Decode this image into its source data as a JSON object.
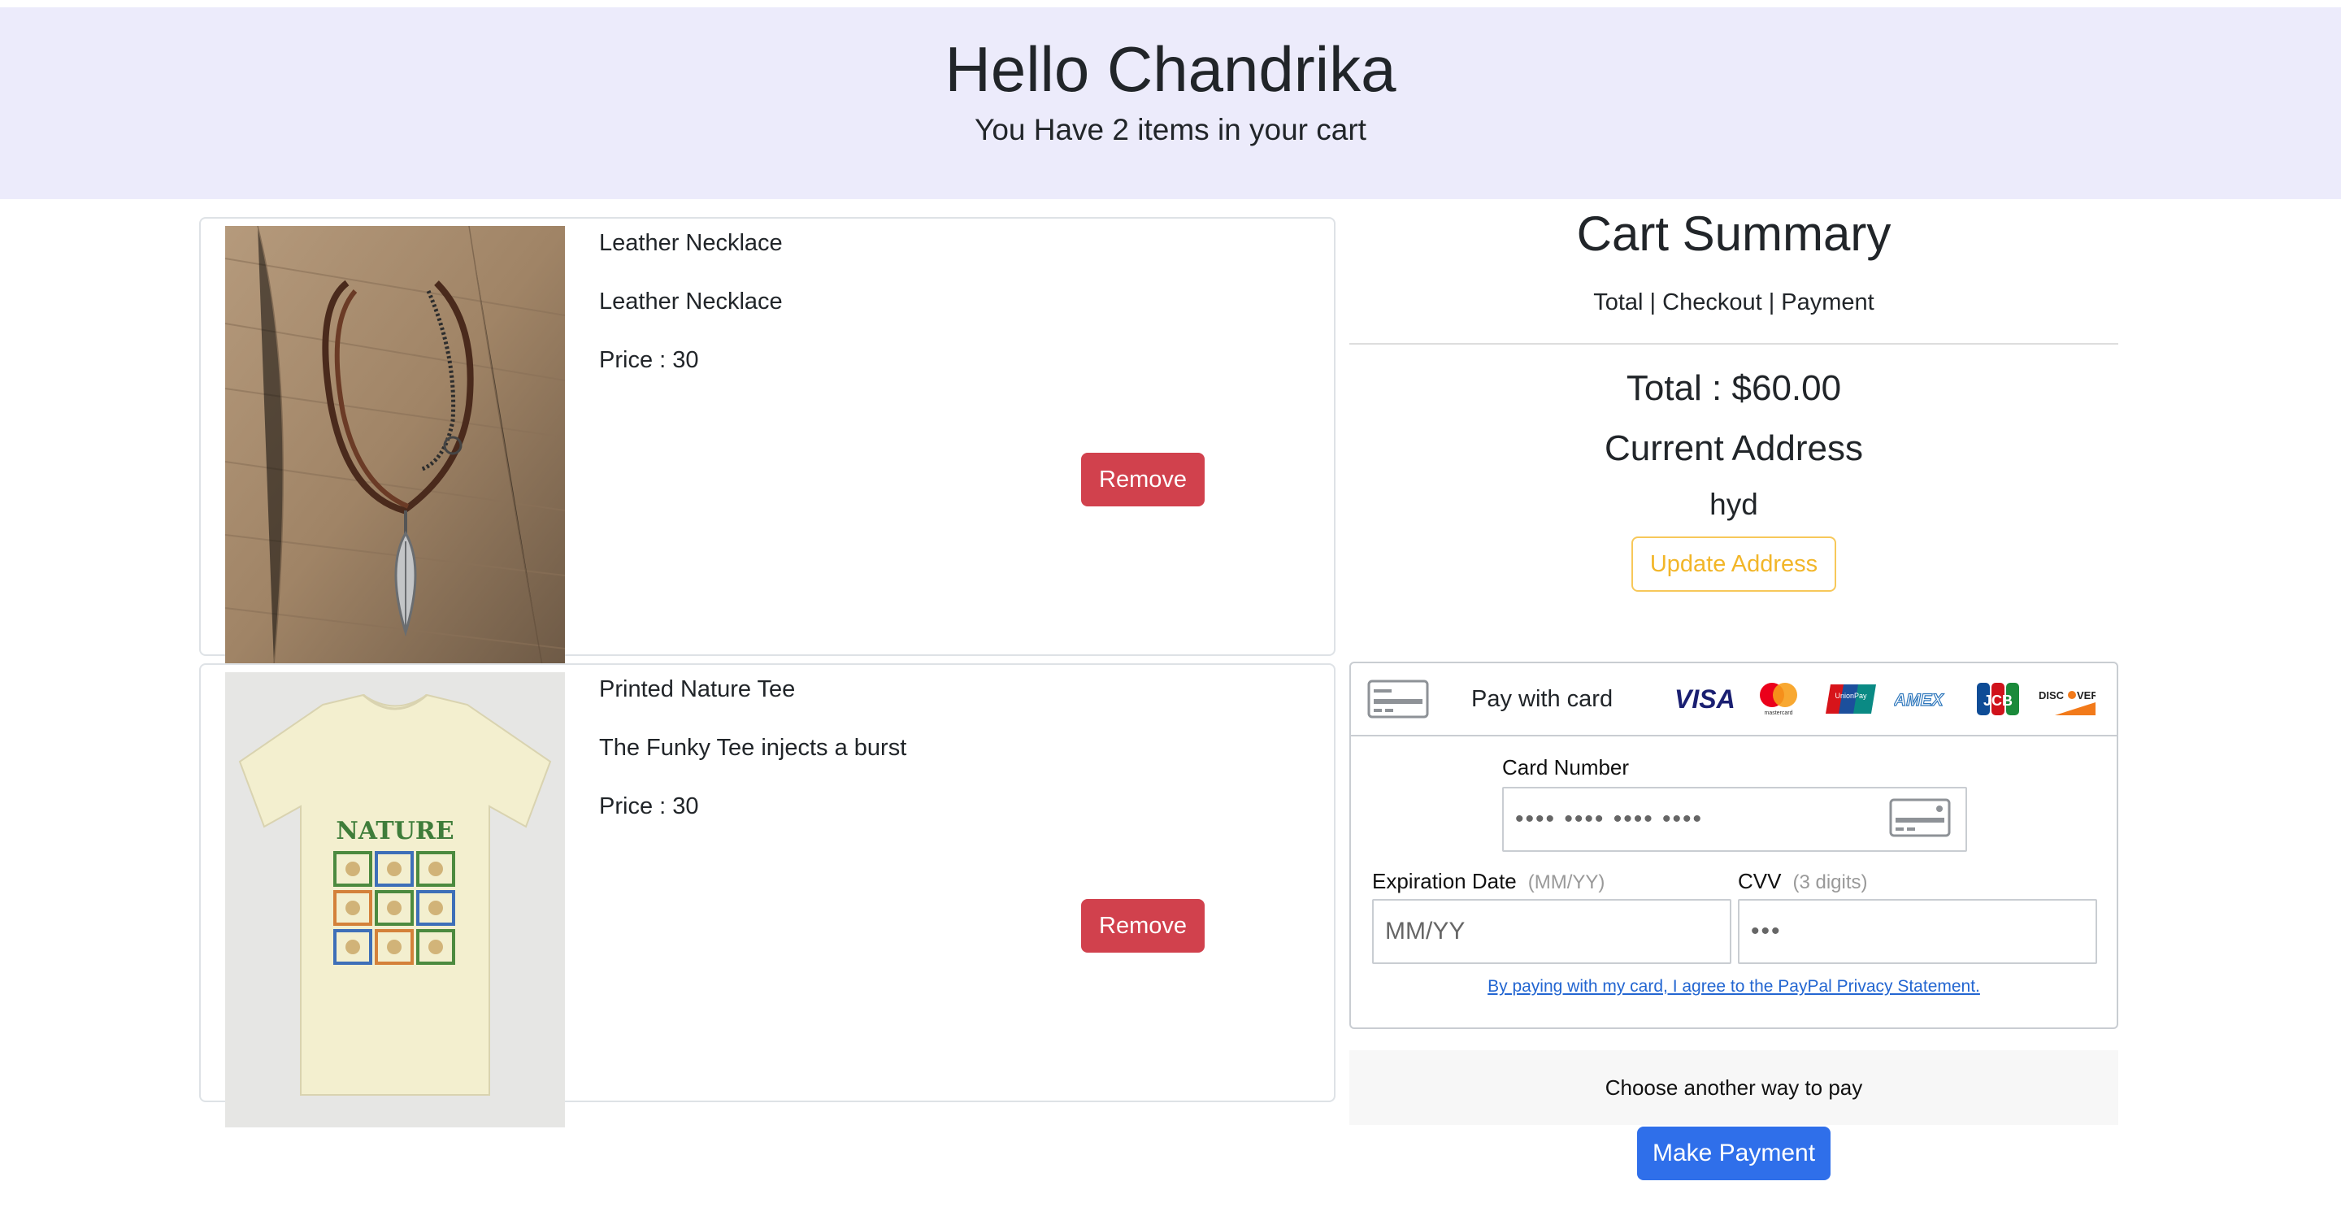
{
  "header": {
    "greeting": "Hello Chandrika",
    "subtitle": "You Have 2 items in your cart"
  },
  "cart": {
    "items": [
      {
        "title": "Leather Necklace",
        "description": "Leather Necklace",
        "price_label": "Price : 30",
        "remove_label": "Remove",
        "image_icon": "leather-necklace-photo"
      },
      {
        "title": "Printed Nature Tee",
        "description": "The Funky Tee injects a burst",
        "price_label": "Price : 30",
        "remove_label": "Remove",
        "image_icon": "nature-tshirt-photo",
        "shirt_print": "NATURE"
      }
    ]
  },
  "summary": {
    "title": "Cart Summary",
    "steps": "Total | Checkout | Payment",
    "total": "Total : $60.00",
    "address_label": "Current Address",
    "address_value": "hyd",
    "update_address_label": "Update Address"
  },
  "payment": {
    "header_label": "Pay with card",
    "brands": [
      "VISA",
      "mastercard",
      "UnionPay",
      "AMEX",
      "JCB",
      "DISCOVER"
    ],
    "card_number_label": "Card Number",
    "card_number_placeholder": "•••• •••• •••• ••••",
    "expiration_label": "Expiration Date",
    "expiration_hint": "(MM/YY)",
    "expiration_placeholder": "MM/YY",
    "cvv_label": "CVV",
    "cvv_hint": "(3 digits)",
    "cvv_placeholder": "•••",
    "privacy_text": "By paying with my card, I agree to the PayPal Privacy Statement.",
    "another_way_label": "Choose another way to pay",
    "make_payment_label": "Make Payment"
  },
  "colors": {
    "header_bg": "#ecebfb",
    "remove_button": "#d1414d",
    "update_address": "#f2b629",
    "make_payment": "#2f6fea",
    "link": "#2366d1"
  }
}
